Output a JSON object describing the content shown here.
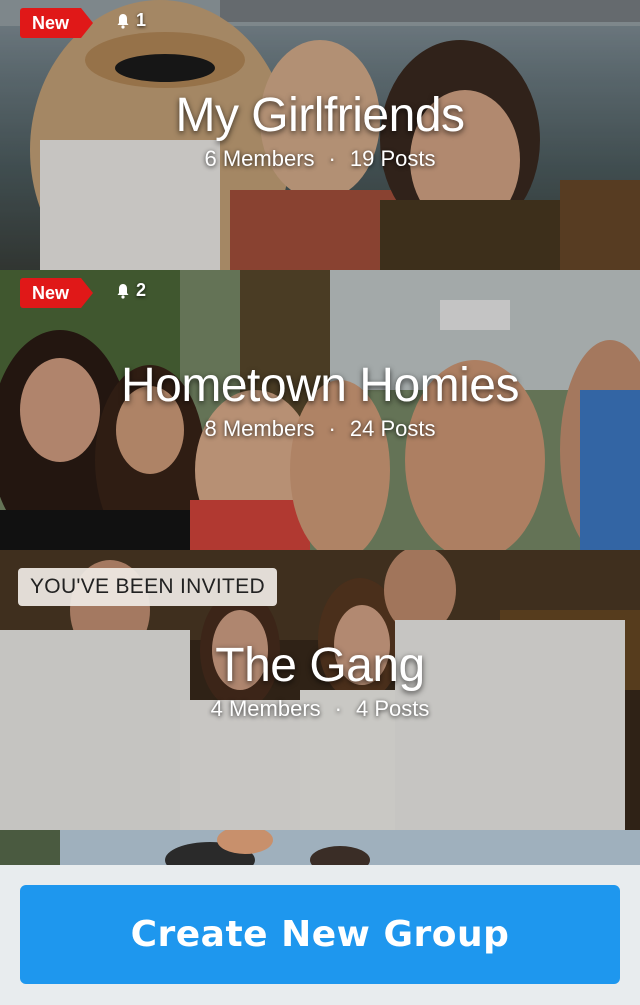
{
  "groups": [
    {
      "title": "My Girlfriends",
      "members": "6 Members",
      "posts": "19 Posts",
      "badge": "New",
      "notifications": "1"
    },
    {
      "title": "Hometown Homies",
      "members": "8 Members",
      "posts": "24 Posts",
      "badge": "New",
      "notifications": "2"
    },
    {
      "title": "The Gang",
      "members": "4 Members",
      "posts": "4 Posts",
      "invite": "YOU'VE BEEN INVITED"
    }
  ],
  "meta_separator": "·",
  "footer": {
    "create_label": "Create New Group"
  },
  "colors": {
    "badge_red": "#e01818",
    "button_blue": "#1e97ee",
    "footer_bg": "#e8ecee"
  }
}
